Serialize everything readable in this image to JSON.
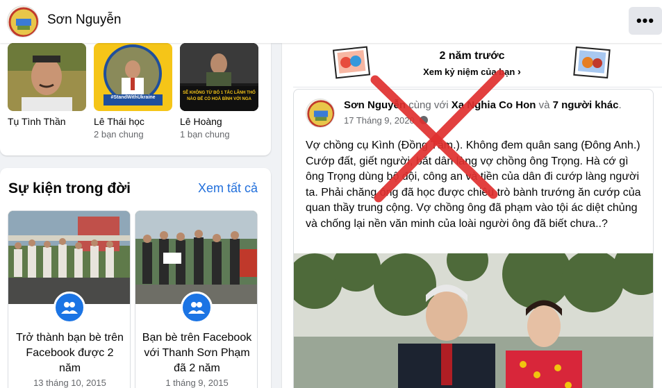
{
  "profile": {
    "name": "Sơn Nguyễn",
    "more_label": "•••"
  },
  "friends": [
    {
      "name": "Tụ Tình Thần",
      "mutual": ""
    },
    {
      "name": "Lê Thái học",
      "mutual": "2 bạn chung",
      "photo_caption": "#StandWithUkraine"
    },
    {
      "name": "Lê Hoàng",
      "mutual": "1 bạn chung",
      "photo_caption": "SẼ KHÔNG TỪ BỎ 1 TẤC LÃNH THỔ NÀO ĐỂ CÓ HOÀ BÌNH VỚI NGA"
    }
  ],
  "events": {
    "title": "Sự kiện trong đời",
    "see_all": "Xem tất cả",
    "items": [
      {
        "text": "Trở thành bạn bè trên Facebook được 2 năm",
        "date": "13 tháng 10, 2015",
        "icon": "friends-icon"
      },
      {
        "text": "Bạn bè trên Facebook với Thanh Sơn Phạm đã 2 năm",
        "date": "1 tháng 9, 2015",
        "icon": "friends-icon"
      }
    ]
  },
  "memory": {
    "years_ago": "2 năm trước",
    "link": "Xem kỷ niệm của bạn"
  },
  "post": {
    "author": "Sơn Nguyễn",
    "with_text": "cùng với",
    "tagged": "Xa Nghia Co Hon",
    "and_text": "và",
    "others": "7 người khác",
    "date": "17 Tháng 9, 2020",
    "text": "Vợ chồng cụ Kình (Đồng Tâm.). Không đem quân sang (Đông Anh.) Cướp đất, giết người, bắt dân làng vợ chồng ông Trọng. Hà cớ gì ông Trọng dùng bộ đội, công an và tiền của dân đi cướp làng người ta. Phải chăng ông đã học được chiêu trò bành trướng ăn cướp của quan thầy trung cộng. Vợ chồng ông đã phạm vào tội ác diệt chủng và chống lại nền văn minh của loài người ông đã biết chưa..?"
  },
  "colors": {
    "accent": "#1b74e4",
    "link": "#216fdb",
    "cross": "#e0302f"
  }
}
